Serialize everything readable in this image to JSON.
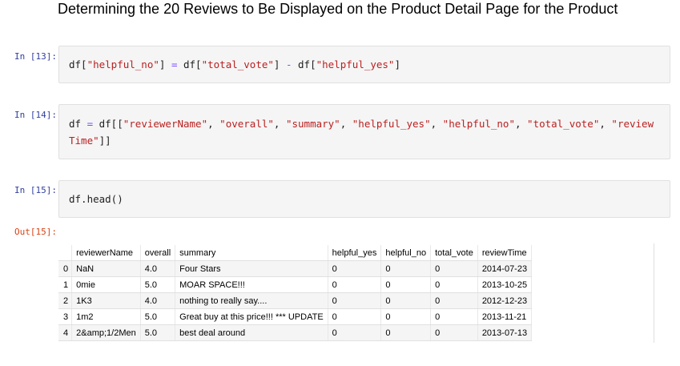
{
  "heading": "Determining the 20 Reviews to Be Displayed on the Product Detail Page for the Product",
  "cells": [
    {
      "prompt": "In [13]:",
      "tokens": [
        {
          "t": "df[",
          "c": ""
        },
        {
          "t": "\"helpful_no\"",
          "c": "str"
        },
        {
          "t": "] ",
          "c": ""
        },
        {
          "t": "=",
          "c": "op"
        },
        {
          "t": " df[",
          "c": ""
        },
        {
          "t": "\"total_vote\"",
          "c": "str"
        },
        {
          "t": "] ",
          "c": ""
        },
        {
          "t": "-",
          "c": "op"
        },
        {
          "t": " df[",
          "c": ""
        },
        {
          "t": "\"helpful_yes\"",
          "c": "str"
        },
        {
          "t": "]",
          "c": ""
        }
      ]
    },
    {
      "prompt": "In [14]:",
      "tokens": [
        {
          "t": "df ",
          "c": ""
        },
        {
          "t": "=",
          "c": "op"
        },
        {
          "t": " df[[",
          "c": ""
        },
        {
          "t": "\"reviewerName\"",
          "c": "str"
        },
        {
          "t": ", ",
          "c": ""
        },
        {
          "t": "\"overall\"",
          "c": "str"
        },
        {
          "t": ", ",
          "c": ""
        },
        {
          "t": "\"summary\"",
          "c": "str"
        },
        {
          "t": ", ",
          "c": ""
        },
        {
          "t": "\"helpful_yes\"",
          "c": "str"
        },
        {
          "t": ", ",
          "c": ""
        },
        {
          "t": "\"helpful_no\"",
          "c": "str"
        },
        {
          "t": ", ",
          "c": ""
        },
        {
          "t": "\"total_vote\"",
          "c": "str"
        },
        {
          "t": ", ",
          "c": ""
        },
        {
          "t": "\"review\nTime\"",
          "c": "str"
        },
        {
          "t": "]]",
          "c": ""
        }
      ]
    },
    {
      "prompt": "In [15]:",
      "tokens": [
        {
          "t": "df.head()",
          "c": ""
        }
      ]
    }
  ],
  "output": {
    "prompt": "Out[15]:",
    "columns": [
      "",
      "reviewerName",
      "overall",
      "summary",
      "helpful_yes",
      "helpful_no",
      "total_vote",
      "reviewTime"
    ],
    "rows": [
      [
        "0",
        "NaN",
        "4.0",
        "Four Stars",
        "0",
        "0",
        "0",
        "2014-07-23"
      ],
      [
        "1",
        "0mie",
        "5.0",
        "MOAR SPACE!!!",
        "0",
        "0",
        "0",
        "2013-10-25"
      ],
      [
        "2",
        "1K3",
        "4.0",
        "nothing to really say....",
        "0",
        "0",
        "0",
        "2012-12-23"
      ],
      [
        "3",
        "1m2",
        "5.0",
        "Great buy at this price!!! *** UPDATE",
        "0",
        "0",
        "0",
        "2013-11-21"
      ],
      [
        "4",
        "2&amp;1/2Men",
        "5.0",
        "best deal around",
        "0",
        "0",
        "0",
        "2013-07-13"
      ]
    ]
  }
}
